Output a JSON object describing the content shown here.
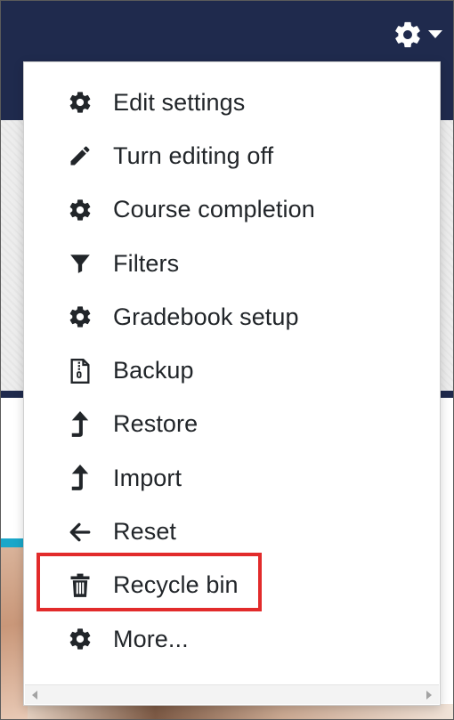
{
  "menu": {
    "items": [
      {
        "label": "Edit settings",
        "icon": "gear-icon"
      },
      {
        "label": "Turn editing off",
        "icon": "pencil-icon"
      },
      {
        "label": "Course completion",
        "icon": "gear-icon"
      },
      {
        "label": "Filters",
        "icon": "filter-icon"
      },
      {
        "label": "Gradebook setup",
        "icon": "gear-icon"
      },
      {
        "label": "Backup",
        "icon": "file-archive-icon"
      },
      {
        "label": "Restore",
        "icon": "level-up-icon"
      },
      {
        "label": "Import",
        "icon": "level-up-icon"
      },
      {
        "label": "Reset",
        "icon": "arrow-left-icon"
      },
      {
        "label": "Recycle bin",
        "icon": "trash-icon"
      },
      {
        "label": "More...",
        "icon": "gear-icon"
      }
    ]
  },
  "colors": {
    "navbar": "#1f2a4d",
    "highlight": "#e22b2b",
    "text": "#212529",
    "accent": "#1aa7c9"
  },
  "highlighted_item": "Recycle bin"
}
